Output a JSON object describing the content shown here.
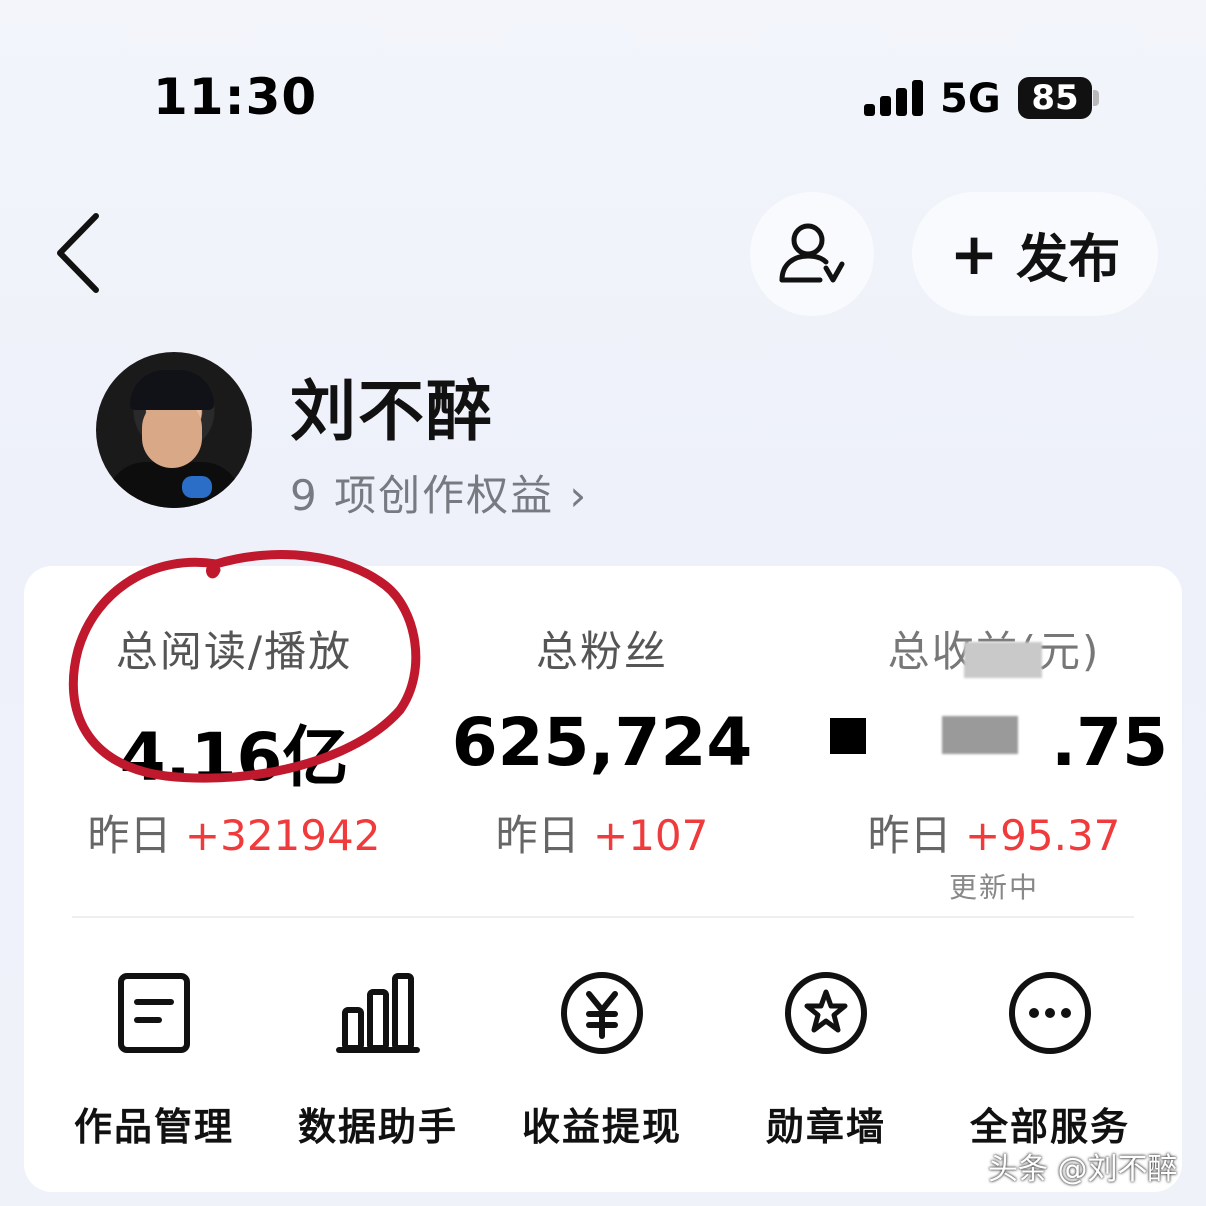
{
  "status_bar": {
    "time": "11:30",
    "network": "5G",
    "battery": "85"
  },
  "header": {
    "publish_label": "发布"
  },
  "profile": {
    "name": "刘不醉",
    "rights": "9 项创作权益 ›"
  },
  "stats": [
    {
      "label": "总阅读/播放",
      "value": "4.16亿",
      "yesterday_prefix": "昨日 ",
      "yesterday_delta": "+321942"
    },
    {
      "label": "总粉丝",
      "value": "625,724",
      "yesterday_prefix": "昨日 ",
      "yesterday_delta": "+107"
    },
    {
      "label": "总收益(元)",
      "value": ".75",
      "yesterday_prefix": "昨日 ",
      "yesterday_delta": "+95.37",
      "note": "更新中"
    }
  ],
  "menu": [
    {
      "label": "作品管理",
      "icon": "document-icon"
    },
    {
      "label": "数据助手",
      "icon": "bar-chart-icon"
    },
    {
      "label": "收益提现",
      "icon": "yuan-icon"
    },
    {
      "label": "勋章墙",
      "icon": "medal-star-icon"
    },
    {
      "label": "全部服务",
      "icon": "more-icon"
    }
  ],
  "watermark": "头条 @刘不醉",
  "colors": {
    "accent_red": "#ef3b3b",
    "annotation_red": "#c0182c"
  }
}
